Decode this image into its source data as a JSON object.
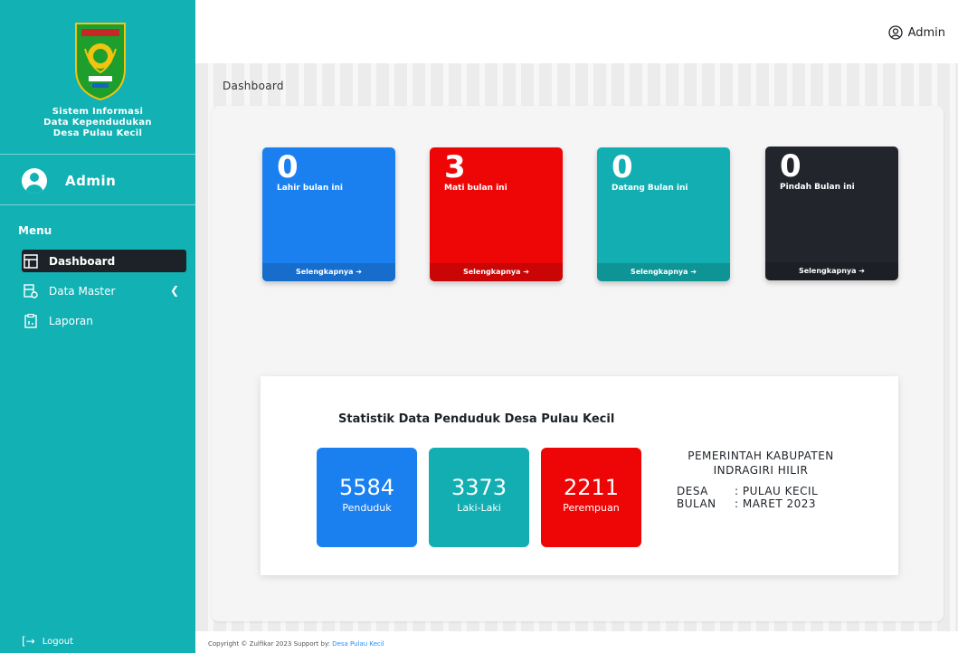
{
  "sidebar": {
    "app_title_line1": "Sistem Informasi",
    "app_title_line2": "Data Kependudukan",
    "app_title_line3": "Desa Pulau Kecil",
    "user_name": "Admin",
    "menu_heading": "Menu",
    "items": [
      {
        "label": "Dashboard",
        "icon": "dashboard-icon",
        "active": true
      },
      {
        "label": "Data Master",
        "icon": "database-icon",
        "active": false,
        "has_submenu": true
      },
      {
        "label": "Laporan",
        "icon": "report-icon",
        "active": false
      }
    ],
    "logout_label": "Logout"
  },
  "topbar": {
    "user_label": "Admin"
  },
  "page_title": "Dashboard",
  "cards": [
    {
      "value": "0",
      "label": "Lahir bulan ini",
      "link": "Selengkapnya ➔",
      "color": "#1a80f0"
    },
    {
      "value": "3",
      "label": "Mati bulan ini",
      "link": "Selengkapnya ➔",
      "color": "#ee0606"
    },
    {
      "value": "0",
      "label": "Datang Bulan ini",
      "link": "Selengkapnya ➔",
      "color": "#12aeb1"
    },
    {
      "value": "0",
      "label": "Pindah Bulan ini",
      "link": "Selengkapnya ➔",
      "color": "#22252c"
    }
  ],
  "stats": {
    "title": "Statistik Data Penduduk Desa Pulau Kecil",
    "items": [
      {
        "value": "5584",
        "label": "Penduduk",
        "color": "#1a80f0"
      },
      {
        "value": "3373",
        "label": "Laki-Laki",
        "color": "#12aeb1"
      },
      {
        "value": "2211",
        "label": "Perempuan",
        "color": "#ee0606"
      }
    ],
    "gov_line1": "PEMERINTAH KABUPATEN",
    "gov_line2": "INDRAGIRI HILIR",
    "desa_key": "DESA",
    "desa_value": ": PULAU KECIL",
    "bulan_key": "BULAN",
    "bulan_value": ": MARET 2023"
  },
  "footer": {
    "text": "Copyright © Zulfikar 2023 Support by: ",
    "link": "Desa Pulau Kecil"
  },
  "colors": {
    "sidebar": "#12b1b4",
    "active_item": "#1d2228"
  }
}
